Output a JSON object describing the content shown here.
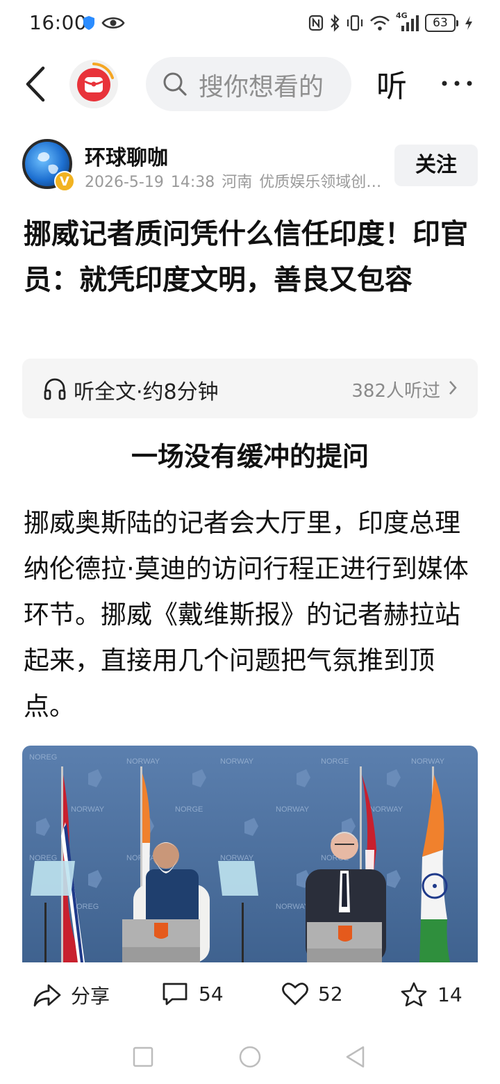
{
  "status_bar": {
    "time": "16:00",
    "network_label": "4G",
    "battery_level": "63"
  },
  "top_nav": {
    "search_placeholder": "搜你想看的",
    "listen_label": "听"
  },
  "author": {
    "name": "环球聊咖",
    "date": "2026-5-19",
    "time": "14:38",
    "location": "河南",
    "tagline": "优质娱乐领域创作者",
    "verified_label": "V",
    "follow_label": "关注"
  },
  "article": {
    "title": "挪威记者质问凭什么信任印度！印官员：就凭印度文明，善良又包容",
    "listen_full_label": "听全文·约8分钟",
    "listen_count": "382人听过",
    "section_heading": "一场没有缓冲的提问",
    "body": "挪威奥斯陆的记者会大厅里，印度总理纳伦德拉·莫迪的访问行程正进行到媒体环节。挪威《戴维斯报》的记者赫拉站起来，直接用几个问题把气氛推到顶点。",
    "photo_backdrop_text": [
      "NORWAY",
      "NORGE",
      "NOREG"
    ]
  },
  "actions": {
    "share_label": "分享",
    "comment_count": "54",
    "like_count": "52",
    "favorite_count": "14"
  },
  "colors": {
    "accent_red": "#e8333a",
    "backdrop_blue": "#4a6e9c",
    "text_primary": "#111111",
    "text_secondary": "#9a9a9a"
  }
}
